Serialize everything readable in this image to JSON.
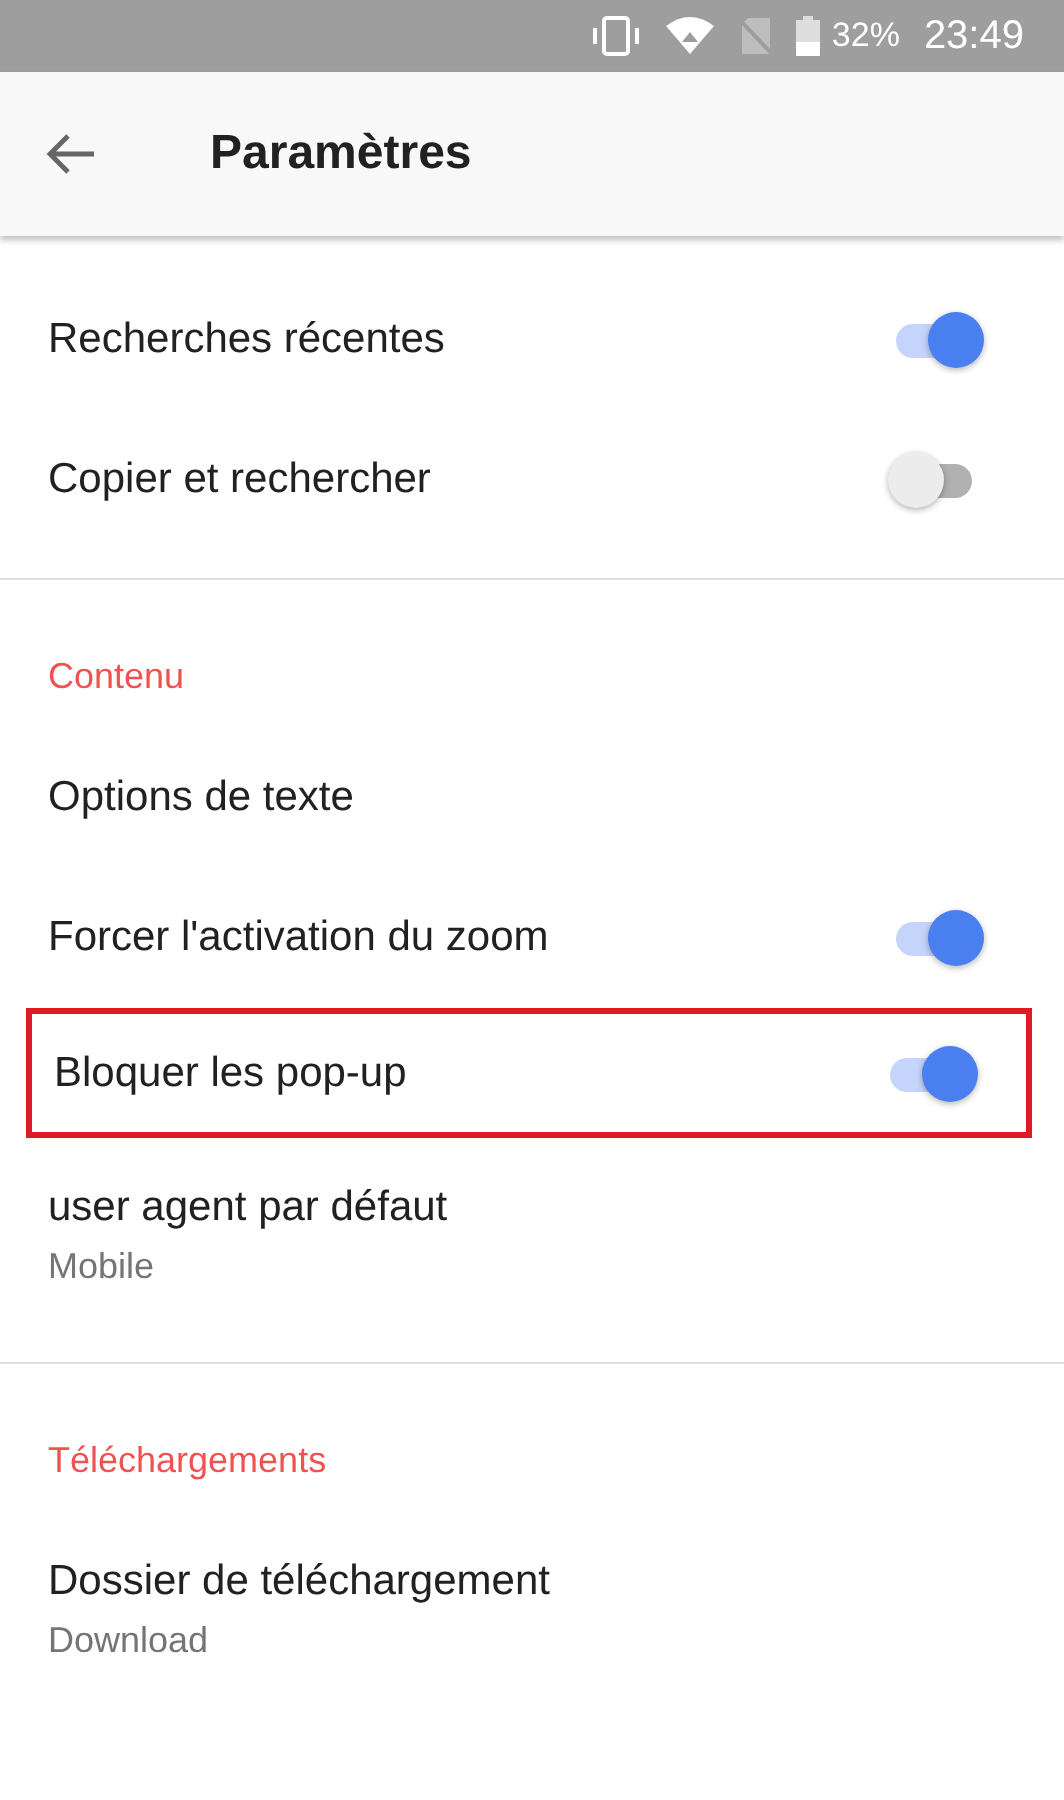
{
  "status_bar": {
    "battery": "32%",
    "time": "23:49"
  },
  "app_bar": {
    "title": "Paramètres"
  },
  "sections": [
    {
      "items": [
        {
          "kind": "toggle",
          "label": "Recherches récentes",
          "on": true,
          "highlighted": false
        },
        {
          "kind": "toggle",
          "label": "Copier et rechercher",
          "on": false,
          "highlighted": false
        }
      ]
    },
    {
      "header": "Contenu",
      "items": [
        {
          "kind": "link",
          "label": "Options de texte",
          "highlighted": false
        },
        {
          "kind": "toggle",
          "label": "Forcer l'activation du zoom",
          "on": true,
          "highlighted": false
        },
        {
          "kind": "toggle",
          "label": "Bloquer les pop-up",
          "on": true,
          "highlighted": true
        },
        {
          "kind": "link",
          "label": "user agent par défaut",
          "summary": "Mobile",
          "highlighted": false
        }
      ]
    },
    {
      "header": "Téléchargements",
      "items": [
        {
          "kind": "link",
          "label": "Dossier de téléchargement",
          "summary": "Download",
          "highlighted": false
        }
      ]
    }
  ]
}
